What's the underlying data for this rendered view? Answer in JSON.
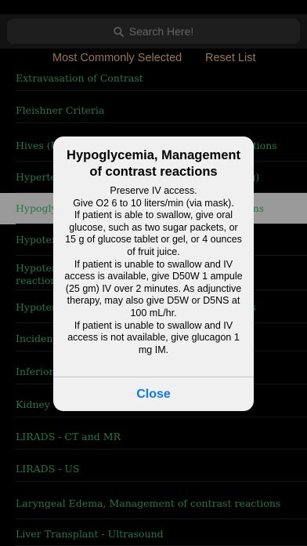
{
  "search": {
    "placeholder": "Search Here!"
  },
  "top_links": {
    "most_common": "Most Commonly Selected",
    "reset": "Reset List"
  },
  "list": {
    "items": [
      "Extravasation of Contrast",
      "Fleishner Criteria",
      "Hives (Urticaria), Management of contrast reactions",
      "Hypertension, Severe (Systolic BP > 200 mmHg)",
      "Hypoglycemia, Management of contrast reactions",
      "Hypotension with Bradycardia (Vagal Reaction)",
      "Hypotension with Tachycardia (Anaphylactoid reaction) to contrast",
      "Hypotension, Management of contrast reactions",
      "Incidental Adrenal Nodule",
      "Inferior Vena Cava",
      "Kidney Transplant",
      "LIRADS - CT and MR",
      "LIRADS - US",
      "Laryngeal Edema, Management of contrast reactions",
      "Liver Transplant - Ultrasound"
    ]
  },
  "dialog": {
    "title": "Hypoglycemia, Management of contrast reactions",
    "body": "Preserve IV access.\nGive O2 6 to 10 liters/min (via mask).\nIf patient is able to swallow, give oral glucose, such as two sugar packets, or 15 g of glucose tablet or gel, or 4 ounces of fruit juice.\nIf patient is unable to swallow and IV access is available, give D50W 1 ampule (25 gm) IV over 2 minutes. As adjunctive therapy, may also give D5W or D5NS at 100 mL/hr.\nIf patient is unable to swallow and IV access is not available, give glucagon 1 mg IM.",
    "close_label": "Close"
  },
  "colors": {
    "list_text": "#2fa55c",
    "top_links": "#d4a16a",
    "selected_row": "#d6d6d6",
    "close_button": "#0a7aff"
  }
}
